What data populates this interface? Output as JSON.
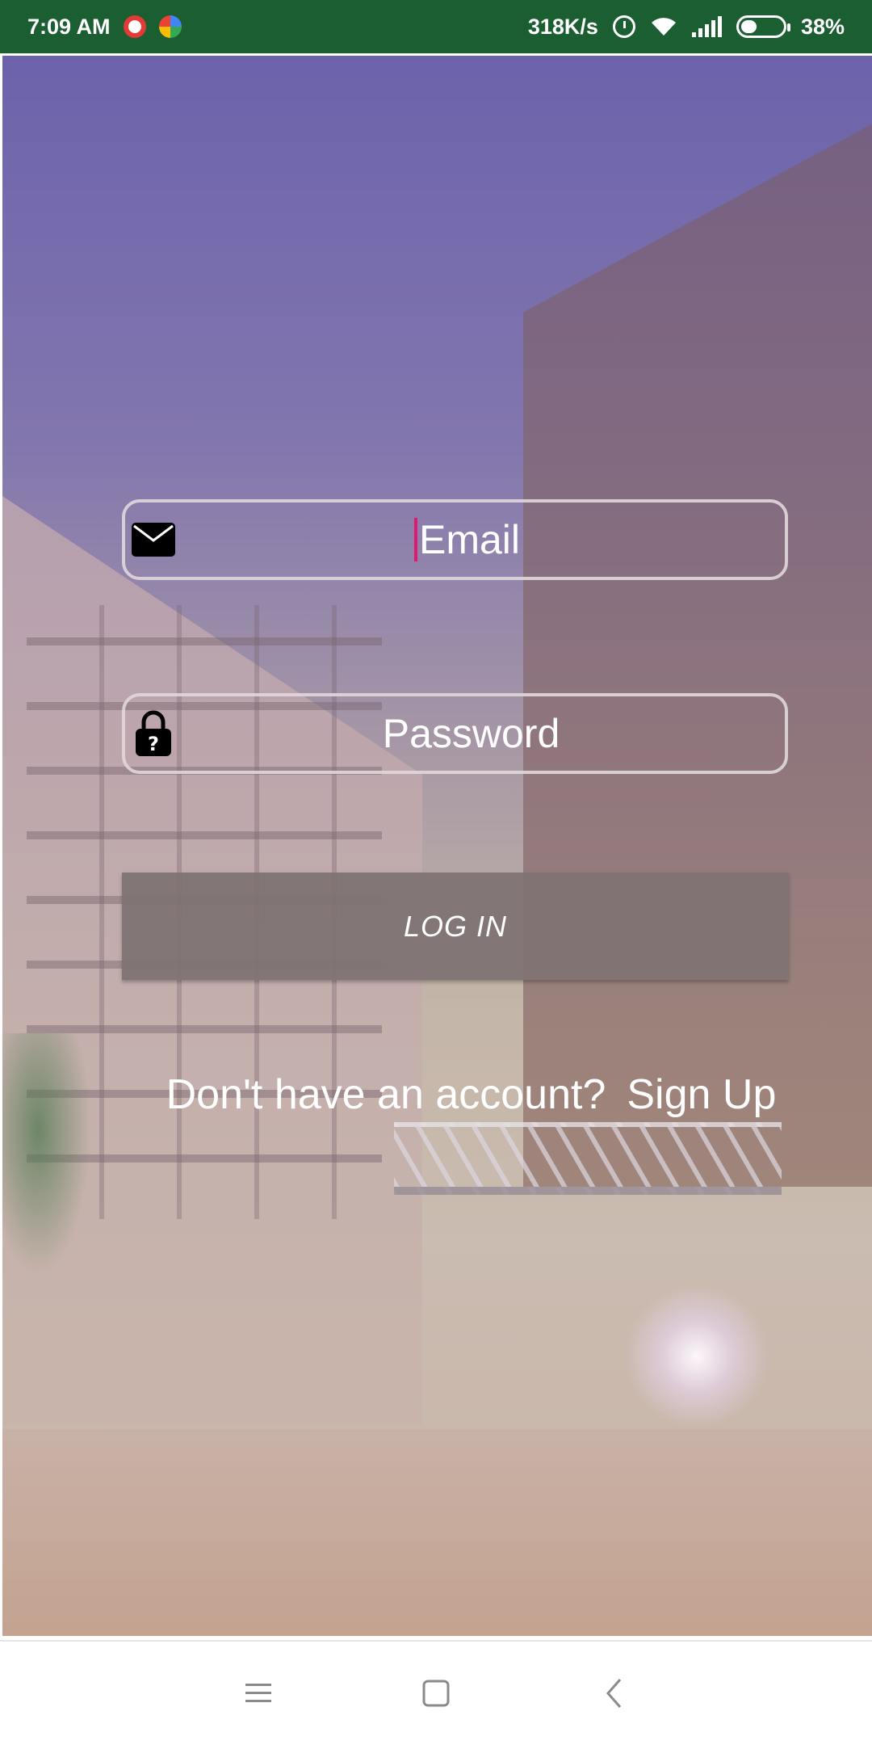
{
  "status_bar": {
    "time": "7:09 AM",
    "network_speed": "318K/s",
    "battery_percent": "38%",
    "battery_level": 0.38,
    "notification_icons": [
      "alarm-clock-app-icon",
      "maps-icon"
    ],
    "system_icons": [
      "alarm-icon",
      "wifi-icon",
      "signal-icon",
      "battery-icon"
    ]
  },
  "form": {
    "email_placeholder": "Email",
    "password_placeholder": "Password",
    "email_icon": "envelope-icon",
    "password_icon": "lock-icon",
    "login_label": "LOG IN"
  },
  "signup": {
    "prompt": "Don't have an account?",
    "link": "Sign Up"
  },
  "nav_bar": {
    "icons": [
      "menu-icon",
      "home-icon",
      "back-icon"
    ]
  },
  "colors": {
    "status_bar": "#1b5e32",
    "caret": "#e0196e",
    "login_button": "#807373",
    "text": "#ffffff"
  }
}
